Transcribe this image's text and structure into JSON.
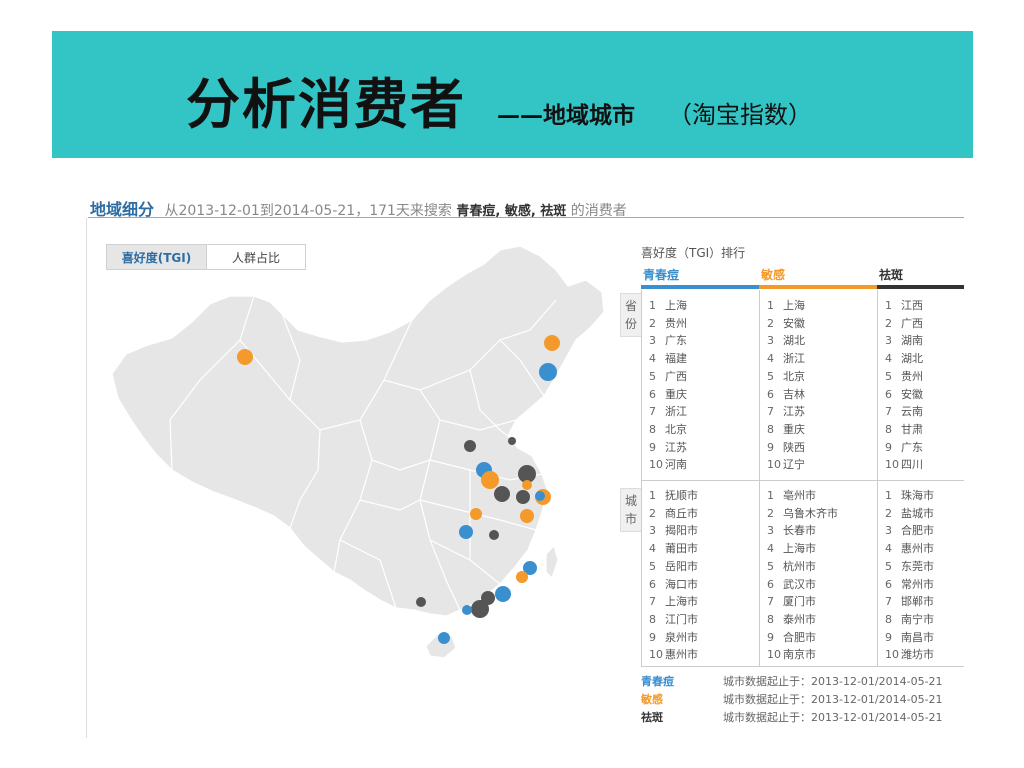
{
  "title": {
    "main": "分析消费者",
    "sub": "——地域城市",
    "paren": "（淘宝指数）"
  },
  "header": {
    "title": "地域细分",
    "range": "从2013-12-01到2014-05-21，171天来搜索",
    "keywords": "青春痘, 敏感, 祛斑",
    "suffix": "的消费者"
  },
  "tabs": [
    {
      "label": "喜好度(TGI)",
      "active": true
    },
    {
      "label": "人群占比",
      "active": false
    }
  ],
  "ranking": {
    "title": "喜好度（TGI）排行",
    "columns": [
      {
        "name": "青春痘",
        "color": "#3a8fcf"
      },
      {
        "name": "敏感",
        "color": "#f39a2b"
      },
      {
        "name": "祛斑",
        "color": "#333333"
      }
    ],
    "province_tag": "省份",
    "city_tag": "城市",
    "provinces": [
      [
        "上海",
        "贵州",
        "广东",
        "福建",
        "广西",
        "重庆",
        "浙江",
        "北京",
        "江苏",
        "河南"
      ],
      [
        "上海",
        "安徽",
        "湖北",
        "浙江",
        "北京",
        "吉林",
        "江苏",
        "重庆",
        "陕西",
        "辽宁"
      ],
      [
        "江西",
        "广西",
        "湖南",
        "湖北",
        "贵州",
        "安徽",
        "云南",
        "甘肃",
        "广东",
        "四川"
      ]
    ],
    "cities": [
      [
        "抚顺市",
        "商丘市",
        "揭阳市",
        "莆田市",
        "岳阳市",
        "海口市",
        "上海市",
        "江门市",
        "泉州市",
        "惠州市"
      ],
      [
        "亳州市",
        "乌鲁木齐市",
        "长春市",
        "上海市",
        "杭州市",
        "武汉市",
        "厦门市",
        "泰州市",
        "合肥市",
        "南京市"
      ],
      [
        "珠海市",
        "盐城市",
        "合肥市",
        "惠州市",
        "东莞市",
        "常州市",
        "邯郸市",
        "南宁市",
        "南昌市",
        "潍坊市"
      ]
    ]
  },
  "footer": [
    {
      "keyword": "青春痘",
      "color": "#3a8fcf",
      "note": "城市数据起止于：2013-12-01/2014-05-21"
    },
    {
      "keyword": "敏感",
      "color": "#f39a2b",
      "note": "城市数据起止于：2013-12-01/2014-05-21"
    },
    {
      "keyword": "祛斑",
      "color": "#333333",
      "note": "城市数据起止于：2013-12-01/2014-05-21"
    }
  ]
}
